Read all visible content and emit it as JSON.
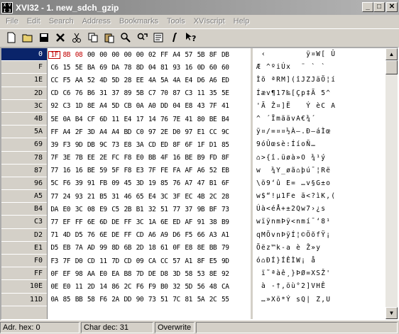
{
  "window": {
    "title": "XVI32 - 1. new_sdch_gzip",
    "icon_text": [
      "X",
      "V",
      "I",
      "3",
      "2",
      "HD"
    ]
  },
  "menu": [
    "File",
    "Edit",
    "Search",
    "Address",
    "Bookmarks",
    "Tools",
    "XVIscript",
    "Help"
  ],
  "toolbar": [
    {
      "name": "new-file-icon"
    },
    {
      "name": "open-folder-icon"
    },
    {
      "name": "save-icon"
    },
    {
      "name": "close-icon"
    },
    {
      "name": "cut-icon"
    },
    {
      "name": "copy-icon"
    },
    {
      "name": "paste-icon"
    },
    {
      "name": "find-icon"
    },
    {
      "name": "replace-icon"
    },
    {
      "name": "settings-icon"
    },
    {
      "name": "info-icon"
    },
    {
      "name": "context-help-icon"
    }
  ],
  "offsets": [
    "0",
    "F",
    "1E",
    "2D",
    "3C",
    "4B",
    "5A",
    "69",
    "78",
    "87",
    "96",
    "A5",
    "B4",
    "C3",
    "D2",
    "E1",
    "F0",
    "FF",
    "10E",
    "11D"
  ],
  "hex_rows": [
    [
      "1F",
      "8B",
      "08",
      "00",
      "00",
      "00",
      "00",
      "00",
      "02",
      "FF",
      "A4",
      "57",
      "5B",
      "8F",
      "DB"
    ],
    [
      "C6",
      "15",
      "5E",
      "BA",
      "69",
      "DA",
      "78",
      "8D",
      "04",
      "81",
      "93",
      "16",
      "0D",
      "60",
      "60"
    ],
    [
      "CC",
      "F5",
      "AA",
      "52",
      "4D",
      "5D",
      "28",
      "EE",
      "4A",
      "5A",
      "4A",
      "E4",
      "D6",
      "A6",
      "ED"
    ],
    [
      "CD",
      "C6",
      "76",
      "B6",
      "31",
      "37",
      "89",
      "5B",
      "C7",
      "70",
      "87",
      "C3",
      "11",
      "35",
      "5E"
    ],
    [
      "92",
      "C3",
      "1D",
      "8E",
      "A4",
      "5D",
      "CB",
      "0A",
      "A0",
      "DD",
      "04",
      "E8",
      "43",
      "7F",
      "41"
    ],
    [
      "5E",
      "0A",
      "B4",
      "CF",
      "6D",
      "11",
      "E4",
      "17",
      "14",
      "76",
      "7E",
      "41",
      "80",
      "BE",
      "B4"
    ],
    [
      "FF",
      "A4",
      "2F",
      "3D",
      "A4",
      "A4",
      "BD",
      "C0",
      "97",
      "2E",
      "D0",
      "97",
      "E1",
      "CC",
      "9C"
    ],
    [
      "39",
      "F3",
      "9D",
      "DB",
      "9C",
      "73",
      "E8",
      "3A",
      "CD",
      "ED",
      "8F",
      "6F",
      "1F",
      "D1",
      "85"
    ],
    [
      "7F",
      "3E",
      "7B",
      "EE",
      "2E",
      "FC",
      "F8",
      "E0",
      "BB",
      "4F",
      "16",
      "BE",
      "B9",
      "FD",
      "8F"
    ],
    [
      "77",
      "16",
      "16",
      "BE",
      "59",
      "5F",
      "F8",
      "E3",
      "7F",
      "FE",
      "FA",
      "AF",
      "A6",
      "52",
      "EB"
    ],
    [
      "5C",
      "F6",
      "39",
      "91",
      "FB",
      "09",
      "45",
      "3D",
      "19",
      "85",
      "76",
      "A7",
      "47",
      "B1",
      "6F"
    ],
    [
      "77",
      "24",
      "93",
      "21",
      "B5",
      "31",
      "46",
      "65",
      "E4",
      "3C",
      "3F",
      "EC",
      "4B",
      "2C",
      "28"
    ],
    [
      "DA",
      "E0",
      "3C",
      "08",
      "E9",
      "C5",
      "2B",
      "B1",
      "32",
      "51",
      "77",
      "37",
      "9B",
      "BF",
      "73"
    ],
    [
      "77",
      "EF",
      "FF",
      "6E",
      "6D",
      "DE",
      "FF",
      "3C",
      "1A",
      "6E",
      "ED",
      "AF",
      "91",
      "38",
      "B9"
    ],
    [
      "71",
      "4D",
      "D5",
      "76",
      "6E",
      "DE",
      "FF",
      "CD",
      "A6",
      "A9",
      "D6",
      "F5",
      "66",
      "A3",
      "A1"
    ],
    [
      "D5",
      "EB",
      "7A",
      "AD",
      "99",
      "8D",
      "6B",
      "2D",
      "18",
      "61",
      "0F",
      "E8",
      "8E",
      "BB",
      "79"
    ],
    [
      "F3",
      "7F",
      "D0",
      "CD",
      "11",
      "7D",
      "CD",
      "09",
      "CA",
      "CC",
      "57",
      "A1",
      "8F",
      "E5",
      "9D"
    ],
    [
      "0F",
      "EF",
      "98",
      "AA",
      "E0",
      "EA",
      "B8",
      "7D",
      "DE",
      "D8",
      "3D",
      "58",
      "53",
      "8E",
      "92"
    ],
    [
      "0E",
      "E0",
      "11",
      "2D",
      "14",
      "86",
      "2C",
      "F6",
      "F9",
      "B0",
      "32",
      "5D",
      "56",
      "48",
      "CA"
    ],
    [
      "0A",
      "85",
      "BB",
      "58",
      "F6",
      "2A",
      "DD",
      "90",
      "73",
      "51",
      "7C",
      "81",
      "5A",
      "2C",
      "55"
    ]
  ],
  "text_rows": [
    " ‹        ÿ¤W[ Û",
    "Æ ^ºiÚx  ¨ ` `",
    "Ìõ ªRM](îJZJäÖ¦í",
    "Íæv¶17‰[Çp‡Ã 5^",
    "'Ã Ž¤]Ë   Ý èC A",
    "^ ´ÏmäävA€¾´",
    "ÿ¤/=¤¤½À—.Ð—áÌœ",
    "9óÛœsè:ÍíoÑ…",
    "⌂>{î.üøà»O ¾¹ý",
    "w  ¾Y_øã⌂þú¯¦Rë",
    "\\ö9‘û E= …v§G±o",
    "w$“!µ1Fe ä<?ìK,(",
    "Úà<éÅ+±2Qw7›¿s",
    "wïÿnmÞÿ<nmí¯‘8¹",
    "qMÕvnÞÿÍ¦©ÖõfŸ¡",
    "Õëz­™k-a è Ž»y",
    "ó⌂ÐÍ}ÍÊÌW¡ å",
    " ï˜ªàê¸}ÞØ=XSŽ'",
    " à -†,öù°2]VHÊ",
    " …»Xö*Ý sQ| Z,U"
  ],
  "status": {
    "address": "Adr. hex: 0",
    "char": "Char dec: 31",
    "mode": "Overwrite"
  }
}
